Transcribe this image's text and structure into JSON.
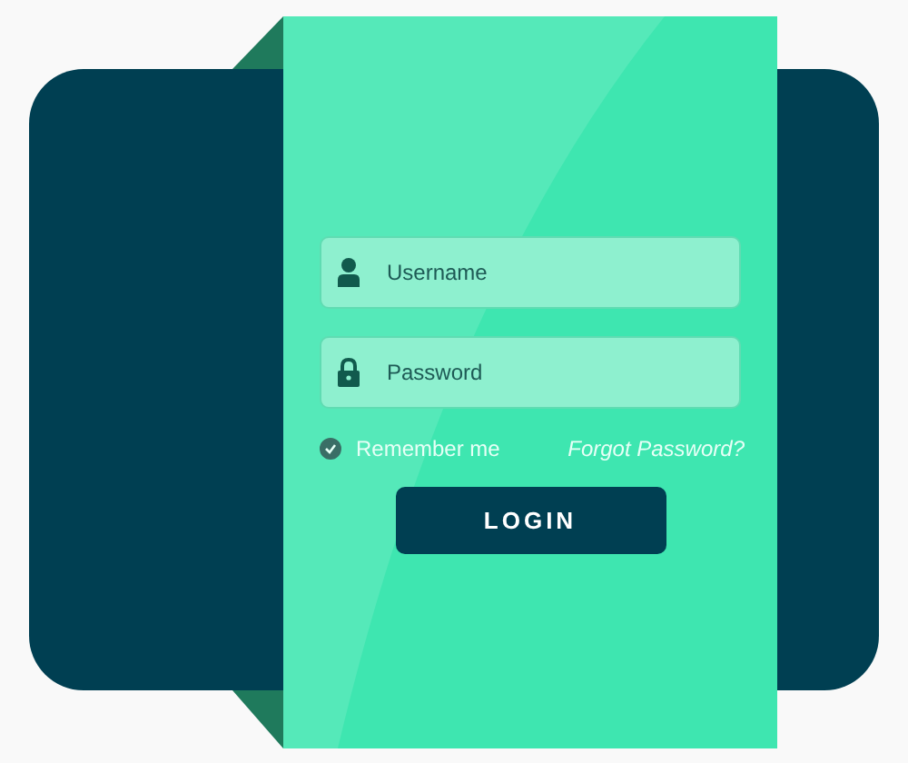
{
  "username": {
    "placeholder": "Username"
  },
  "password": {
    "placeholder": "Password"
  },
  "remember": {
    "label": "Remember me",
    "checked": true
  },
  "forgot_link": "Forgot Password?",
  "login_button": "LOGIN"
}
